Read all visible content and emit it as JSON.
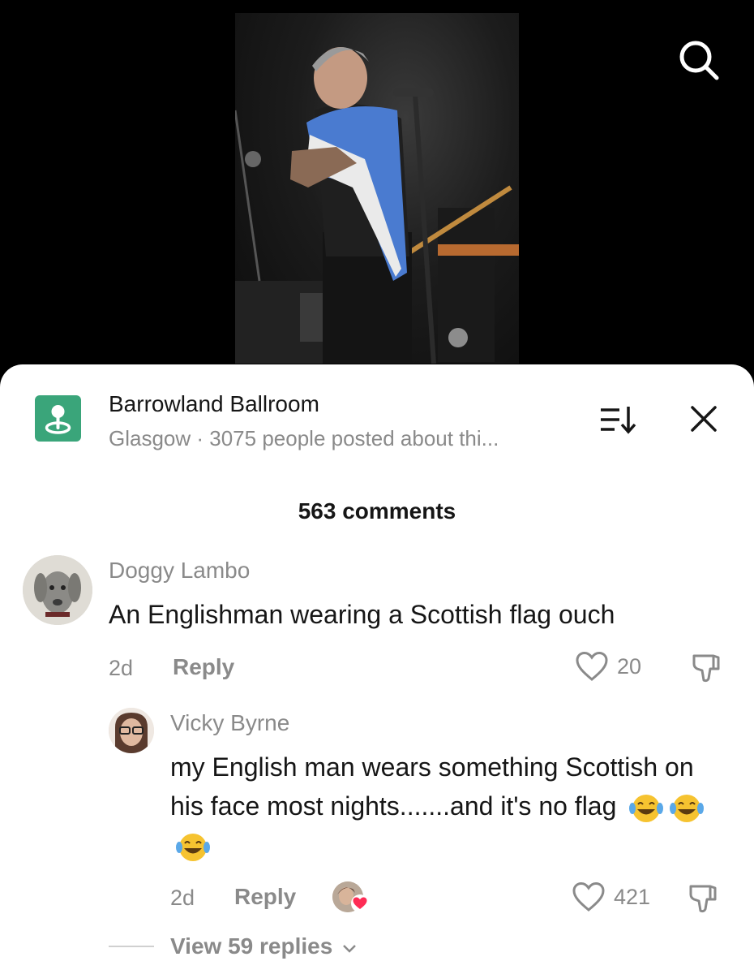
{
  "location": {
    "name": "Barrowland Ballroom",
    "subtitle": "Glasgow · 3075 people posted about thi..."
  },
  "comments_header": "563 comments",
  "comments": [
    {
      "username": "Doggy Lambo",
      "text": "An Englishman wearing a Scottish flag ouch",
      "time": "2d",
      "reply_label": "Reply",
      "likes": "20"
    },
    {
      "username": "Vicky Byrne",
      "text": "my English man wears something Scottish on his face most nights.......and it's no flag",
      "emojis": [
        "face-with-tears-of-joy",
        "face-with-tears-of-joy",
        "face-with-tears-of-joy"
      ],
      "time": "2d",
      "reply_label": "Reply",
      "likes": "421"
    }
  ],
  "view_replies": "View 59 replies",
  "icons": {
    "search": "search-icon",
    "location": "location-pin-icon",
    "sort": "sort-icon",
    "close": "close-icon",
    "like": "heart-icon",
    "dislike": "thumbs-down-icon",
    "chevron": "chevron-down-icon"
  },
  "colors": {
    "location_icon_bg": "#3aa57a",
    "text_primary": "#161616",
    "text_secondary": "#8a8a8a",
    "liked_heart": "#fe2c55"
  }
}
